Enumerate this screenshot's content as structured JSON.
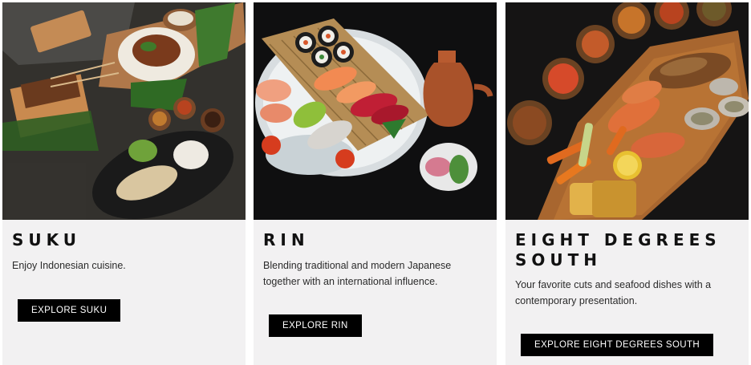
{
  "cards": [
    {
      "title": "SUKU",
      "description": "Enjoy Indonesian cuisine.",
      "button_label": "EXPLORE SUKU",
      "image_alt": "indonesian-dishes-photo"
    },
    {
      "title": "RIN",
      "description": "Blending traditional and modern Japanese together with an international influence.",
      "button_label": "EXPLORE RIN",
      "image_alt": "japanese-sushi-photo"
    },
    {
      "title": "EIGHT DEGREES SOUTH",
      "description": "Your favorite cuts and seafood dishes with a contemporary presentation.",
      "button_label": "EXPLORE EIGHT DEGREES SOUTH",
      "image_alt": "seafood-platter-photo"
    }
  ],
  "colors": {
    "card_background": "#f2f1f2",
    "button_background": "#000000",
    "button_text": "#ffffff",
    "title_text": "#111111"
  }
}
